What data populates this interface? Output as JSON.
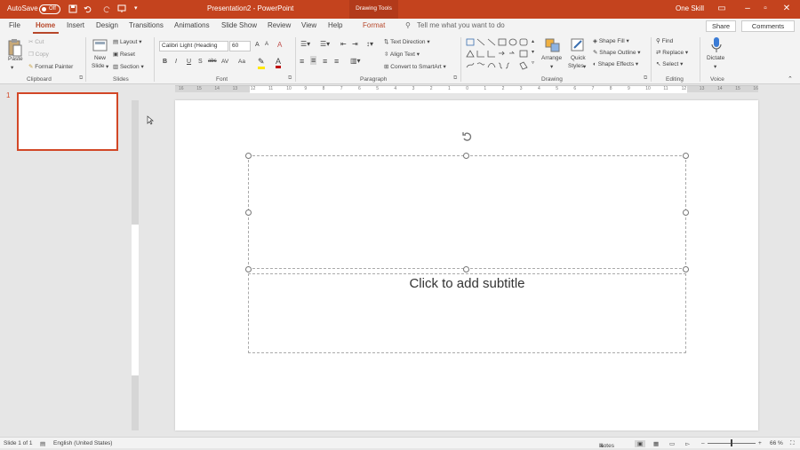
{
  "titlebar": {
    "autosave_label": "AutoSave",
    "autosave_state": "Off",
    "document_title": "Presentation2 - PowerPoint",
    "contextual_group": "Drawing Tools",
    "user_name": "One Skill"
  },
  "tabs": [
    "File",
    "Home",
    "Insert",
    "Design",
    "Transitions",
    "Animations",
    "Slide Show",
    "Review",
    "View",
    "Help",
    "Format"
  ],
  "active_tab": "Home",
  "tell_me": "Tell me what you want to do",
  "share_label": "Share",
  "comments_label": "Comments",
  "clipboard": {
    "paste": "Paste",
    "cut": "Cut",
    "copy": "Copy",
    "format_painter": "Format Painter",
    "group": "Clipboard"
  },
  "slides": {
    "new_slide_1": "New",
    "new_slide_2": "Slide",
    "layout": "Layout",
    "reset": "Reset",
    "section": "Section",
    "group": "Slides"
  },
  "font": {
    "name": "Calibri Light (Heading",
    "size": "60",
    "bold": "B",
    "italic": "I",
    "underline": "U",
    "strike": "S",
    "shadow": "abc",
    "spacing": "AV",
    "case": "Aa",
    "group": "Font"
  },
  "paragraph": {
    "text_direction": "Text Direction",
    "align_text": "Align Text",
    "convert": "Convert to SmartArt",
    "group": "Paragraph"
  },
  "drawing": {
    "arrange": "Arrange",
    "quick_styles_1": "Quick",
    "quick_styles_2": "Styles",
    "shape_fill": "Shape Fill",
    "shape_outline": "Shape Outline",
    "shape_effects": "Shape Effects",
    "group": "Drawing"
  },
  "editing": {
    "find": "Find",
    "replace": "Replace",
    "select": "Select",
    "group": "Editing"
  },
  "voice": {
    "dictate": "Dictate",
    "group": "Voice"
  },
  "thumbnail_number": "1",
  "ruler_top": [
    "16",
    "15",
    "14",
    "13",
    "12",
    "11",
    "10",
    "9",
    "8",
    "7",
    "6",
    "5",
    "4",
    "3",
    "2",
    "1",
    "0",
    "1",
    "2",
    "3",
    "4",
    "5",
    "6",
    "7",
    "8",
    "9",
    "10",
    "11",
    "12",
    "13",
    "14",
    "15",
    "16"
  ],
  "slide": {
    "subtitle_placeholder": "Click to add subtitle"
  },
  "status": {
    "slide_info": "Slide 1 of 1",
    "language": "English (United States)",
    "notes": "Notes",
    "zoom": "66 %"
  },
  "colors": {
    "accent": "#c4431e",
    "active_tab": "#b7472a",
    "selection": "#d24726"
  }
}
